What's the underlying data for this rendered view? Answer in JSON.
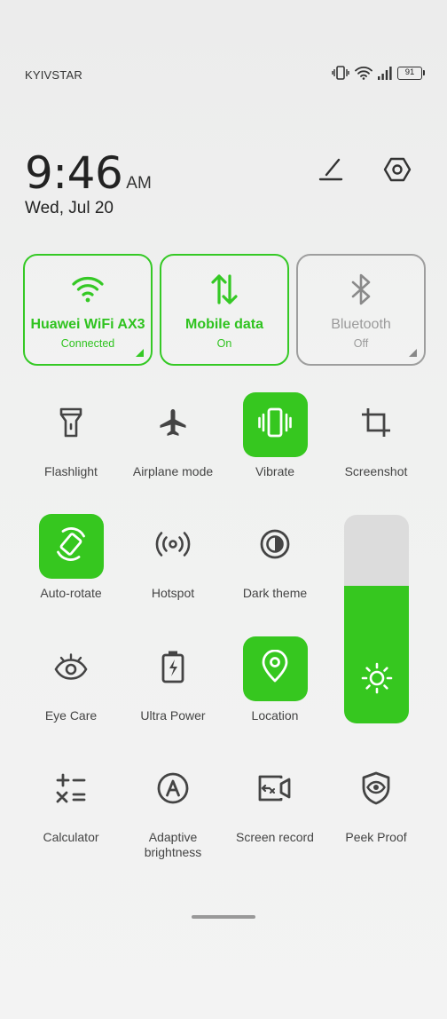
{
  "status_bar": {
    "carrier": "KYIVSTAR",
    "battery": "91",
    "icons": [
      "vibrate-icon",
      "wifi-icon",
      "signal-icon",
      "battery-icon"
    ]
  },
  "clock": {
    "time": "9:46",
    "ampm": "AM",
    "date": "Wed, Jul 20"
  },
  "top_actions": [
    "edit-icon",
    "settings-icon"
  ],
  "big_tiles": [
    {
      "name": "wifi",
      "title": "Huawei WiFi AX3",
      "status": "Connected",
      "on": true,
      "icon": "wifi-icon"
    },
    {
      "name": "mobile-data",
      "title": "Mobile data",
      "status": "On",
      "on": true,
      "icon": "data-arrows-icon"
    },
    {
      "name": "bluetooth",
      "title": "Bluetooth",
      "status": "Off",
      "on": false,
      "icon": "bluetooth-icon"
    }
  ],
  "toggles": [
    {
      "label": "Flashlight",
      "on": false,
      "icon": "flashlight-icon"
    },
    {
      "label": "Airplane mode",
      "on": false,
      "icon": "airplane-icon"
    },
    {
      "label": "Vibrate",
      "on": true,
      "icon": "vibrate-icon"
    },
    {
      "label": "Screenshot",
      "on": false,
      "icon": "crop-icon"
    },
    {
      "label": "Auto-rotate",
      "on": true,
      "icon": "rotate-icon"
    },
    {
      "label": "Hotspot",
      "on": false,
      "icon": "hotspot-icon"
    },
    {
      "label": "Dark theme",
      "on": false,
      "icon": "dark-theme-icon"
    },
    {
      "label": "Eye Care",
      "on": false,
      "icon": "eye-icon"
    },
    {
      "label": "Ultra Power",
      "on": false,
      "icon": "battery-bolt-icon"
    },
    {
      "label": "Location",
      "on": true,
      "icon": "location-icon"
    },
    {
      "label": "Calculator",
      "on": false,
      "icon": "calculator-icon"
    },
    {
      "label": "Adaptive brightness",
      "on": false,
      "icon": "adaptive-brightness-icon"
    },
    {
      "label": "Screen record",
      "on": false,
      "icon": "screen-record-icon"
    },
    {
      "label": "Peek Proof",
      "on": false,
      "icon": "peek-proof-icon"
    }
  ],
  "brightness": {
    "level": 0.66,
    "icon": "sun-icon"
  },
  "colors": {
    "accent": "#36c71f",
    "off_border": "#9e9e9e",
    "text": "#444444"
  }
}
